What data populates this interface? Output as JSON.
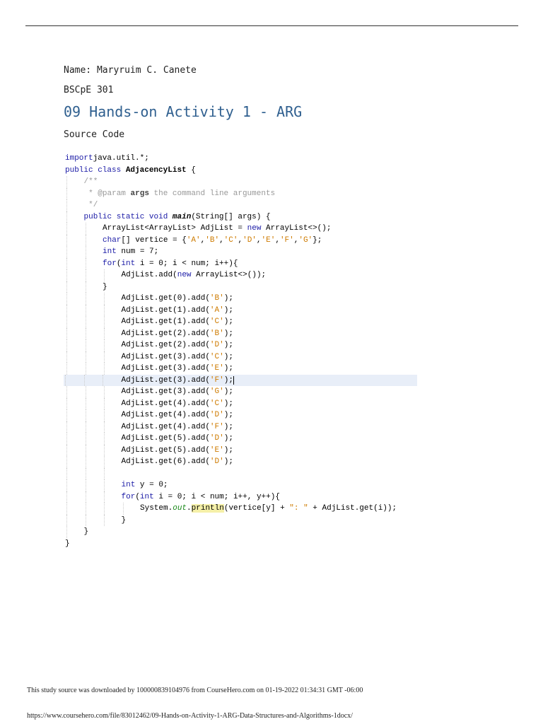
{
  "header": {
    "name": "Name: Maryruim C. Canete",
    "section": "BSCpE 301",
    "title": "09 Hands-on Activity 1 - ARG",
    "source_label": "Source Code"
  },
  "code": [
    {
      "i": 0,
      "s": [
        [
          "kw",
          "import"
        ],
        [
          "",
          "java.util.*;"
        ]
      ]
    },
    {
      "i": 0,
      "s": [
        [
          "kw",
          "public class "
        ],
        [
          "bold",
          "AdjacencyList"
        ],
        [
          "",
          " {"
        ]
      ]
    },
    {
      "i": 1,
      "s": [
        [
          "cm",
          "/**"
        ]
      ]
    },
    {
      "i": 1,
      "s": [
        [
          "cm",
          " * @param "
        ],
        [
          "cmb",
          "args"
        ],
        [
          "cm",
          " the command line arguments"
        ]
      ]
    },
    {
      "i": 1,
      "s": [
        [
          "cm",
          " */"
        ]
      ]
    },
    {
      "i": 1,
      "s": [
        [
          "kw",
          "public static void "
        ],
        [
          "bi",
          "main"
        ],
        [
          "",
          "(String[] args) {"
        ]
      ]
    },
    {
      "i": 2,
      "s": [
        [
          "",
          "ArrayList<ArrayList> AdjList = "
        ],
        [
          "kw",
          "new"
        ],
        [
          "",
          " ArrayList<>();"
        ]
      ]
    },
    {
      "i": 2,
      "s": [
        [
          "kw",
          "char"
        ],
        [
          "",
          "[] vertice = {"
        ],
        [
          "str",
          "'A'"
        ],
        [
          ",",
          ","
        ],
        [
          "str",
          "'B'"
        ],
        [
          ",",
          ","
        ],
        [
          "str",
          "'C'"
        ],
        [
          ",",
          ","
        ],
        [
          "str",
          "'D'"
        ],
        [
          ",",
          ","
        ],
        [
          "str",
          "'E'"
        ],
        [
          ",",
          ","
        ],
        [
          "str",
          "'F'"
        ],
        [
          ",",
          ","
        ],
        [
          "str",
          "'G'"
        ],
        [
          "",
          "};"
        ]
      ]
    },
    {
      "i": 2,
      "s": [
        [
          "kw",
          "int"
        ],
        [
          "",
          " num = 7;"
        ]
      ]
    },
    {
      "i": 2,
      "s": [
        [
          "kw",
          "for"
        ],
        [
          "",
          "("
        ],
        [
          "kw",
          "int"
        ],
        [
          "",
          " i = 0; i < num; i++){"
        ]
      ]
    },
    {
      "i": 3,
      "s": [
        [
          "",
          "AdjList.add("
        ],
        [
          "kw",
          "new"
        ],
        [
          "",
          " ArrayList<>());"
        ]
      ]
    },
    {
      "i": 2,
      "s": [
        [
          "",
          "}"
        ]
      ]
    },
    {
      "i": 3,
      "s": [
        [
          "",
          "AdjList.get(0).add("
        ],
        [
          "str",
          "'B'"
        ],
        [
          "",
          ");"
        ]
      ]
    },
    {
      "i": 3,
      "s": [
        [
          "",
          "AdjList.get(1).add("
        ],
        [
          "str",
          "'A'"
        ],
        [
          "",
          ");"
        ]
      ]
    },
    {
      "i": 3,
      "s": [
        [
          "",
          "AdjList.get(1).add("
        ],
        [
          "str",
          "'C'"
        ],
        [
          "",
          ");"
        ]
      ]
    },
    {
      "i": 3,
      "s": [
        [
          "",
          "AdjList.get(2).add("
        ],
        [
          "str",
          "'B'"
        ],
        [
          "",
          ");"
        ]
      ]
    },
    {
      "i": 3,
      "s": [
        [
          "",
          "AdjList.get(2).add("
        ],
        [
          "str",
          "'D'"
        ],
        [
          "",
          ");"
        ]
      ]
    },
    {
      "i": 3,
      "s": [
        [
          "",
          "AdjList.get(3).add("
        ],
        [
          "str",
          "'C'"
        ],
        [
          "",
          ");"
        ]
      ]
    },
    {
      "i": 3,
      "s": [
        [
          "",
          "AdjList.get(3).add("
        ],
        [
          "str",
          "'E'"
        ],
        [
          "",
          ");"
        ]
      ]
    },
    {
      "i": 3,
      "hl": true,
      "s": [
        [
          "",
          "AdjList.get(3).add("
        ],
        [
          "str",
          "'F'"
        ],
        [
          "",
          ");"
        ],
        [
          "cursor",
          ""
        ]
      ]
    },
    {
      "i": 3,
      "s": [
        [
          "",
          "AdjList.get(3).add("
        ],
        [
          "str",
          "'G'"
        ],
        [
          "",
          ");"
        ]
      ]
    },
    {
      "i": 3,
      "s": [
        [
          "",
          "AdjList.get(4).add("
        ],
        [
          "str",
          "'C'"
        ],
        [
          "",
          ");"
        ]
      ]
    },
    {
      "i": 3,
      "s": [
        [
          "",
          "AdjList.get(4).add("
        ],
        [
          "str",
          "'D'"
        ],
        [
          "",
          ");"
        ]
      ]
    },
    {
      "i": 3,
      "s": [
        [
          "",
          "AdjList.get(4).add("
        ],
        [
          "str",
          "'F'"
        ],
        [
          "",
          ");"
        ]
      ]
    },
    {
      "i": 3,
      "s": [
        [
          "",
          "AdjList.get(5).add("
        ],
        [
          "str",
          "'D'"
        ],
        [
          "",
          ");"
        ]
      ]
    },
    {
      "i": 3,
      "s": [
        [
          "",
          "AdjList.get(5).add("
        ],
        [
          "str",
          "'E'"
        ],
        [
          "",
          ");"
        ]
      ]
    },
    {
      "i": 3,
      "s": [
        [
          "",
          "AdjList.get(6).add("
        ],
        [
          "str",
          "'D'"
        ],
        [
          "",
          ");"
        ]
      ]
    },
    {
      "i": 3,
      "s": []
    },
    {
      "i": 3,
      "s": [
        [
          "kw",
          "int"
        ],
        [
          "",
          " y = 0;"
        ]
      ]
    },
    {
      "i": 3,
      "s": [
        [
          "kw",
          "for"
        ],
        [
          "",
          "("
        ],
        [
          "kw",
          "int"
        ],
        [
          "",
          " i = 0; i < num; i++, y++){"
        ]
      ]
    },
    {
      "i": 4,
      "s": [
        [
          "",
          "System."
        ],
        [
          "fld",
          "out"
        ],
        [
          "",
          "."
        ],
        [
          "mark",
          "println"
        ],
        [
          "",
          "(vertice[y] + "
        ],
        [
          "str",
          "\": \""
        ],
        [
          "",
          " + AdjList.get(i));"
        ]
      ]
    },
    {
      "i": 3,
      "s": [
        [
          "",
          "}"
        ]
      ]
    },
    {
      "i": 1,
      "s": [
        [
          "",
          "}"
        ]
      ]
    },
    {
      "i": 0,
      "s": [
        [
          "",
          "}"
        ]
      ]
    }
  ],
  "footer": {
    "download_note": "This study source was downloaded by 100000839104976 from CourseHero.com on 01-19-2022 01:34:31 GMT -06:00",
    "url": "https://www.coursehero.com/file/83012462/09-Hands-on-Activity-1-ARG-Data-Structures-and-Algorithms-1docx/"
  }
}
